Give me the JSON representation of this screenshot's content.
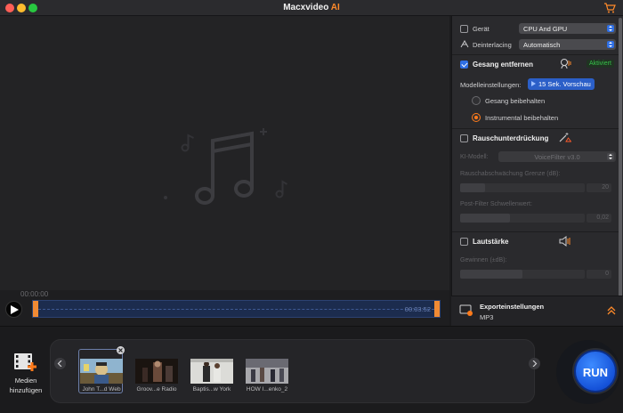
{
  "app": {
    "title": "Macxvideo",
    "title_accent": "AI"
  },
  "timeline": {
    "current_time": "00:00:00",
    "end_time": "00:03:52"
  },
  "panel": {
    "geraet": {
      "label": "Gerät",
      "value": "CPU And GPU"
    },
    "deinterlacing": {
      "label": "Deinterlacing",
      "value": "Automatisch"
    },
    "vocal_removal": {
      "label": "Gesang entfernen",
      "checked": true,
      "status_badge": "Aktiviert",
      "model_settings_label": "Modelleinstellungen:",
      "preview_button": "15 Sek. Vorschau",
      "options": [
        {
          "label": "Gesang beibehalten",
          "selected": false
        },
        {
          "label": "Instrumental beibehalten",
          "selected": true
        }
      ]
    },
    "noise_reduction": {
      "label": "Rauschunterdrückung",
      "checked": false,
      "model_label": "KI-Modell:",
      "model_value": "VoiceFilter v3.0",
      "threshold_label": "Rauschabschwächung Grenze (dB):",
      "threshold_value": "20",
      "threshold_level": 0.2,
      "postfilter_label": "Post-Filter Schwellenwert:",
      "postfilter_value": "0,02",
      "postfilter_level": 0.4
    },
    "volume": {
      "label": "Lautstärke",
      "checked": false,
      "gain_label": "Gewinnen (±dB):",
      "gain_value": "0",
      "gain_level": 0.5
    },
    "export": {
      "title": "Exporteinstellungen",
      "format": "MP3"
    }
  },
  "media": {
    "add_label_line1": "Medien",
    "add_label_line2": "hinzufügen",
    "items": [
      {
        "caption": "John T...d Web",
        "selected": true
      },
      {
        "caption": "Groov...e Radio",
        "selected": false
      },
      {
        "caption": "Baptis...w York",
        "selected": false
      },
      {
        "caption": "HOW I...enko_2",
        "selected": false
      }
    ]
  },
  "run_button": "RUN",
  "colors": {
    "accent": "#2f6fe4",
    "brand_orange": "#ff8a2a",
    "active_green": "#36c04a",
    "run_blue": "#1552d9"
  }
}
